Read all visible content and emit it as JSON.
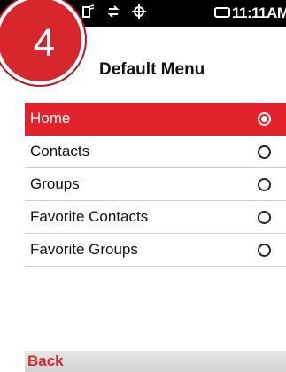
{
  "step_badge": "4",
  "status_bar": {
    "time": "11:11AM",
    "icons": [
      "signal-icon",
      "sync-icon",
      "gps-icon",
      "battery-icon"
    ]
  },
  "screen": {
    "title": "Default Menu",
    "items": [
      {
        "label": "Home",
        "selected": true
      },
      {
        "label": "Contacts",
        "selected": false
      },
      {
        "label": "Groups",
        "selected": false
      },
      {
        "label": "Favorite Contacts",
        "selected": false
      },
      {
        "label": "Favorite Groups",
        "selected": false
      }
    ]
  },
  "softkeys": {
    "left": "Back"
  },
  "colors": {
    "accent": "#e3222b",
    "status_bar": "#000000"
  }
}
